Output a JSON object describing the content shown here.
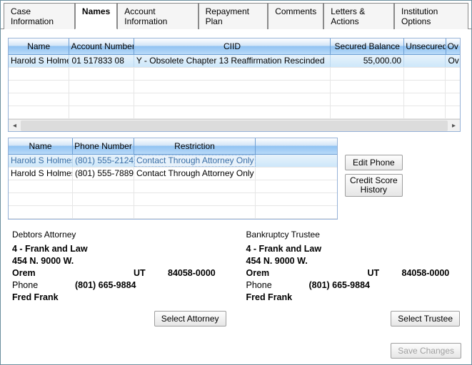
{
  "tabs": {
    "items": [
      {
        "label": "Case Information"
      },
      {
        "label": "Names"
      },
      {
        "label": "Account Information"
      },
      {
        "label": "Repayment Plan"
      },
      {
        "label": "Comments"
      },
      {
        "label": "Letters & Actions"
      },
      {
        "label": "Institution Options"
      }
    ],
    "activeIndex": 1
  },
  "accountsGrid": {
    "headers": {
      "name": "Name",
      "account": "Account Number",
      "ciid": "CIID",
      "secured": "Secured Balance",
      "unsecured_short": "Unsecured",
      "over_short": "Ov"
    },
    "rows": [
      {
        "name": "Harold S Holmes",
        "account": "01 517833 08",
        "ciid": "Y  - Obsolete Chapter 13 Reaffirmation Rescinded",
        "secured": "55,000.00",
        "unsecured": "",
        "over": "Ov"
      }
    ]
  },
  "contactsGrid": {
    "headers": {
      "name": "Name",
      "phone": "Phone Number",
      "restriction": "Restriction",
      "blank": ""
    },
    "rows": [
      {
        "name": "Harold S Holmes",
        "phone": "(801) 555-2124",
        "restriction": "Contact Through Attorney Only"
      },
      {
        "name": "Harold S Holmes",
        "phone": "(801) 555-7889",
        "restriction": "Contact Through Attorney Only"
      }
    ]
  },
  "buttons": {
    "editPhone": "Edit Phone",
    "creditScoreHistory": "Credit Score History",
    "selectAttorney": "Select Attorney",
    "selectTrustee": "Select Trustee",
    "saveChanges": "Save Changes"
  },
  "attorney": {
    "title": "Debtors Attorney",
    "firm": "4 - Frank and Law",
    "street": "454 N. 9000 W.",
    "city": "Orem",
    "state": "UT",
    "zip": "84058-0000",
    "phoneLabel": "Phone",
    "phone": "(801) 665-9884",
    "contact": "Fred Frank"
  },
  "trustee": {
    "title": "Bankruptcy Trustee",
    "firm": "4 - Frank and Law",
    "street": "454 N. 9000 W.",
    "city": "Orem",
    "state": "UT",
    "zip": "84058-0000",
    "phoneLabel": "Phone",
    "phone": "(801) 665-9884",
    "contact": "Fred Frank"
  }
}
